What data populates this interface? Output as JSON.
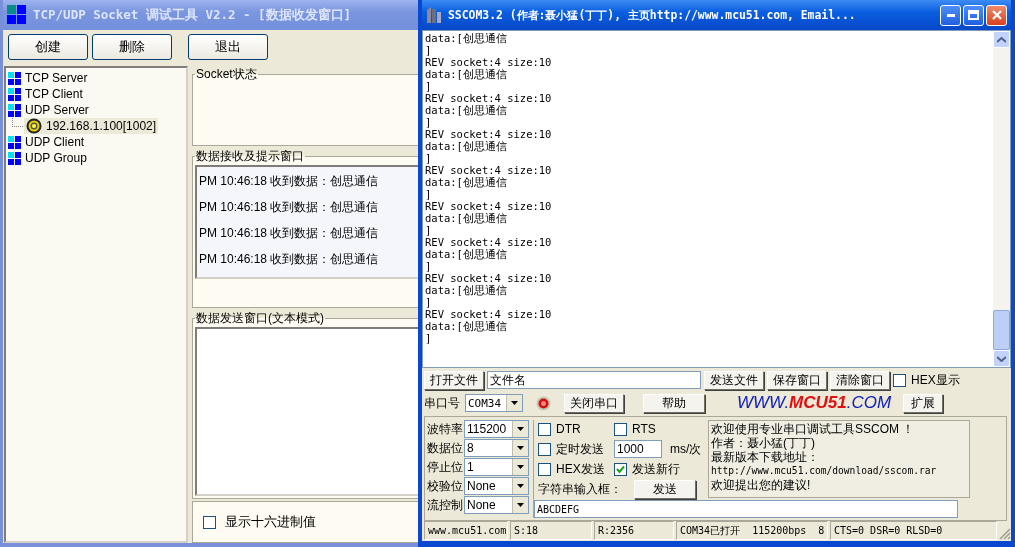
{
  "tcp_window": {
    "title": "TCP/UDP Socket 调试工具 V2.2 - [数据收发窗口]",
    "active": false,
    "toolbar": [
      "创建",
      "删除",
      "退出"
    ],
    "tree": [
      {
        "label": "TCP Server",
        "selected": false
      },
      {
        "label": "TCP Client",
        "selected": false
      },
      {
        "label": "UDP Server",
        "selected": false,
        "children": [
          {
            "label": "192.168.1.100[1002]",
            "selected": true
          }
        ]
      },
      {
        "label": "UDP Client",
        "selected": false
      },
      {
        "label": "UDP Group",
        "selected": false
      }
    ],
    "socket_status": {
      "title": "Socket状态"
    },
    "receive": {
      "title": "数据接收及提示窗口",
      "messages": [
        "PM 10:46:18 收到数据：创思通信",
        "PM 10:46:18 收到数据：创思通信",
        "PM 10:46:18 收到数据：创思通信",
        "PM 10:46:18 收到数据：创思通信"
      ]
    },
    "send": {
      "title": "数据发送窗口(文本模式)"
    },
    "hex_checkbox": {
      "label": "显示十六进制值",
      "checked": false
    }
  },
  "sscom_window": {
    "title": "SSCOM3.2 (作者:聂小猛(丁丁), 主页http://www.mcu51.com,  Email...",
    "active": true,
    "log": [
      "data:[创思通信",
      "]",
      "REV socket:4 size:10",
      "data:[创思通信",
      "]",
      "REV socket:4 size:10",
      "data:[创思通信",
      "]",
      "REV socket:4 size:10",
      "data:[创思通信",
      "]",
      "REV socket:4 size:10",
      "data:[创思通信",
      "]",
      "REV socket:4 size:10",
      "data:[创思通信",
      "]",
      "REV socket:4 size:10",
      "data:[创思通信",
      "]",
      "REV socket:4 size:10",
      "data:[创思通信",
      "]",
      "REV socket:4 size:10",
      "data:[创思通信",
      "]"
    ],
    "open_file_button": "打开文件",
    "file_field": {
      "value": "文件名"
    },
    "file_buttons": [
      "发送文件",
      "保存窗口",
      "清除窗口"
    ],
    "hex_display": {
      "label": "HEX显示",
      "checked": false
    },
    "port_label": "串口号",
    "port": "COM34",
    "port_open": true,
    "close_port_button": "关闭串口",
    "help_button": "帮助",
    "logo": {
      "prefix": "WWW.",
      "highlight": "MCU51",
      "suffix": ".COM"
    },
    "expand_button": "扩展",
    "settings": [
      {
        "label": "波特率",
        "value": "115200"
      },
      {
        "label": "数据位",
        "value": "8"
      },
      {
        "label": "停止位",
        "value": "1"
      },
      {
        "label": "校验位",
        "value": "None"
      },
      {
        "label": "流控制",
        "value": "None"
      }
    ],
    "dtr": {
      "label": "DTR",
      "checked": false
    },
    "rts": {
      "label": "RTS",
      "checked": false
    },
    "timed_send": {
      "label": "定时发送",
      "checked": false
    },
    "interval": "1000",
    "interval_unit": "ms/次",
    "hex_send": {
      "label": "HEX发送",
      "checked": false
    },
    "send_newline": {
      "label": "发送新行",
      "checked": true
    },
    "input_label": "字符串输入框：",
    "send_button": "发送",
    "info": [
      "欢迎使用专业串口调试工具SSCOM ！",
      "作者：聂小猛(丁丁)",
      "最新版本下载地址：",
      "http://www.mcu51.com/download/sscom.rar",
      "欢迎提出您的建议!"
    ],
    "input_value": "ABCDEFG",
    "status_bar": [
      "www.mcu51.com",
      "S:18",
      "R:2356",
      "COM34已打开  115200bps  8",
      "CTS=0 DSR=0 RLSD=0"
    ]
  }
}
